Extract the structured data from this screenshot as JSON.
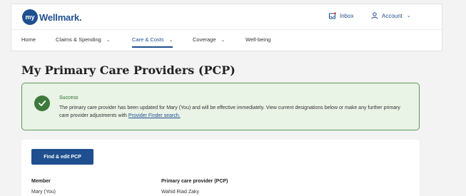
{
  "brand": {
    "my": "my",
    "name": "Wellmark",
    "dot": "."
  },
  "header": {
    "inbox_label": "Inbox",
    "account_label": "Account"
  },
  "nav": {
    "items": [
      {
        "label": "Home",
        "has_dropdown": false
      },
      {
        "label": "Claims & Spending",
        "has_dropdown": true
      },
      {
        "label": "Care & Costs",
        "has_dropdown": true,
        "active": true
      },
      {
        "label": "Coverage",
        "has_dropdown": true
      },
      {
        "label": "Well-being",
        "has_dropdown": false
      }
    ]
  },
  "page": {
    "title": "My Primary Care Providers (PCP)"
  },
  "alert": {
    "title": "Success",
    "message": "The primary care provider has been updated for Mary (You) and will be effective immediately. View current designations below or make any further primary care provider adjustments with ",
    "link": "Provider Finder search."
  },
  "card": {
    "button_label": "Find & edit PCP",
    "columns": [
      "Member",
      "Primary care provider (PCP)"
    ],
    "rows": [
      [
        "Mary (You)",
        "Wahid Riad Zaky"
      ]
    ]
  },
  "colors": {
    "brand_blue": "#1f4f8f",
    "success_green": "#3d7a3c",
    "success_bg": "#e9f3e6"
  },
  "icons": {
    "inbox": "inbox-icon",
    "account": "person-icon",
    "success": "check-circle-icon"
  }
}
